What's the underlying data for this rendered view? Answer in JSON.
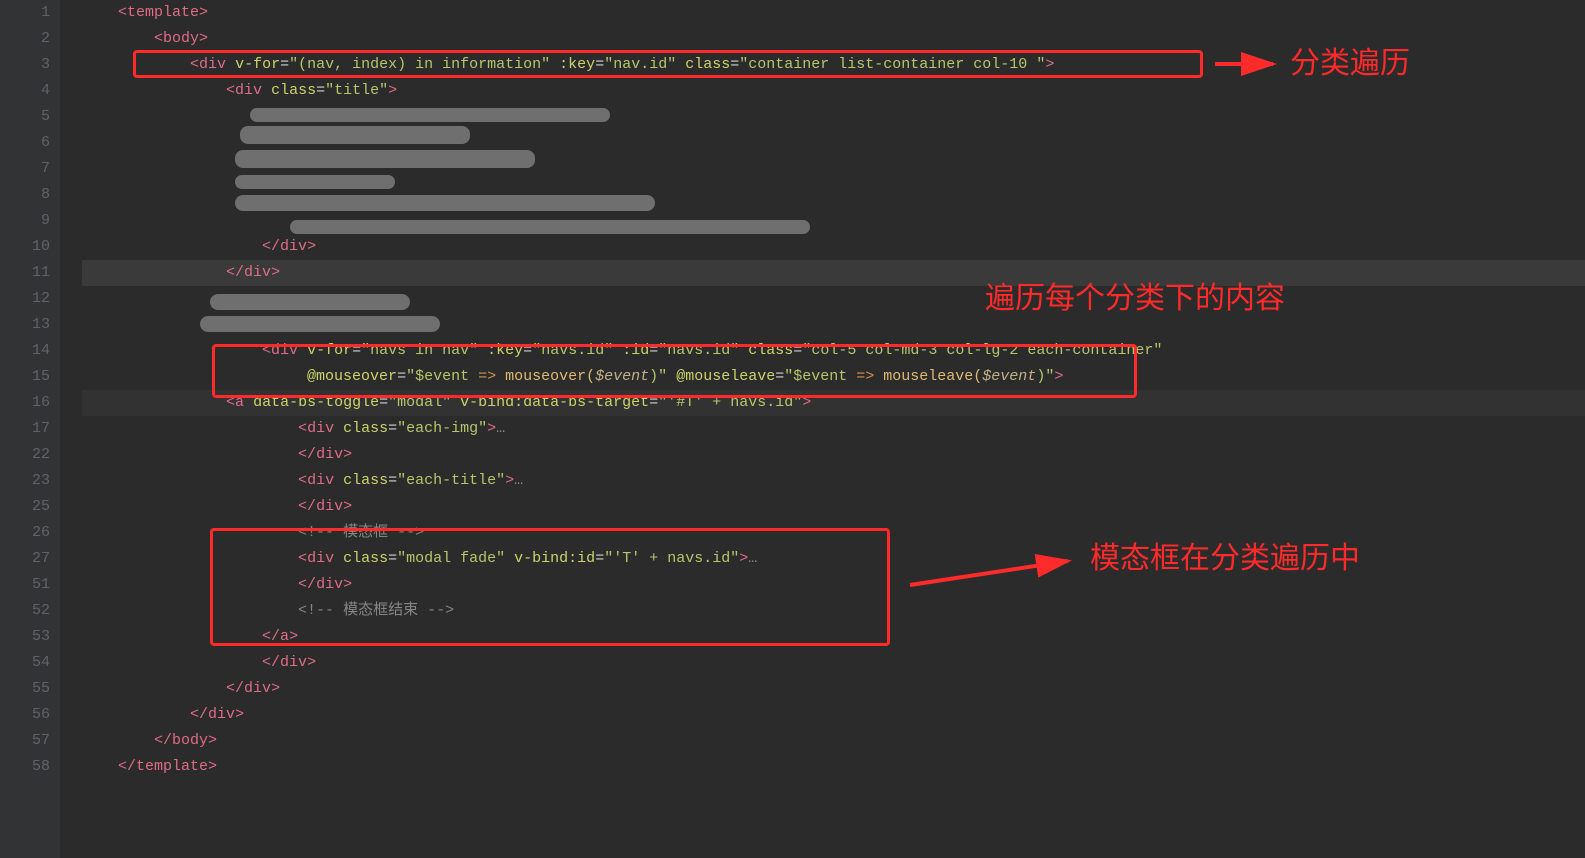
{
  "gutter": {
    "lines": [
      "1",
      "2",
      "3",
      "4",
      "5",
      "6",
      "7",
      "8",
      "9",
      "10",
      "11",
      "12",
      "13",
      "14",
      "15",
      "16",
      "17",
      "22",
      "23",
      "25",
      "26",
      "27",
      "51",
      "52",
      "53",
      "54",
      "55",
      "56",
      "57",
      "58"
    ],
    "fold_rows": [
      "17",
      "27"
    ]
  },
  "code": {
    "l1": {
      "open": "<",
      "tag": "template",
      "close": ">"
    },
    "l2": {
      "open": "<",
      "tag": "body",
      "close": ">"
    },
    "l3": {
      "open": "<",
      "tag": "div",
      "a1": "v-for",
      "v1": "\"(nav, index) in information\"",
      "a2": ":key",
      "v2": "\"nav.id\"",
      "a3": "class",
      "v3": "\"container list-container col-10 \"",
      "close": ">"
    },
    "l4": {
      "open": "<",
      "tag": "div",
      "a1": "class",
      "v1": "\"title\"",
      "close": ">"
    },
    "l10": {
      "open": "</",
      "tag": "div",
      "close": ">"
    },
    "l11": {
      "open": "</",
      "tag": "div",
      "close": ">"
    },
    "l14": {
      "open": "<",
      "tag": "div",
      "a1": "v-for",
      "v1": "\"navs in nav\"",
      "a2": ":key",
      "v2": "\"navs.id\"",
      "a3": ":id",
      "v3": "\"navs.id\"",
      "a4": "class",
      "v4": "\"col-5 col-md-3 col-lg-2 each-container\""
    },
    "l15": {
      "a1": "@mouseover",
      "v1a": "\"$event ",
      "v1b": "=>",
      "v1c": " mouseover(",
      "v1d": "$event",
      "v1e": ")\"",
      "a2": "@mouseleave",
      "v2a": "\"$event ",
      "v2b": "=>",
      "v2c": " mouseleave(",
      "v2d": "$event",
      "v2e": ")\"",
      "close": ">"
    },
    "l16": {
      "open": "<",
      "tag": "a",
      "a1": "data-bs-toggle",
      "v1": "\"modal\"",
      "a2": "v-bind:data-bs-target",
      "v2": "\"'#T' + navs.id\"",
      "close": ">"
    },
    "l17": {
      "open": "<",
      "tag": "div",
      "a1": "class",
      "v1": "\"each-img\"",
      "close": ">",
      "dots": "…"
    },
    "l22": {
      "open": "</",
      "tag": "div",
      "close": ">"
    },
    "l23": {
      "open": "<",
      "tag": "div",
      "a1": "class",
      "v1": "\"each-title\"",
      "close": ">",
      "dots": "…"
    },
    "l25": {
      "open": "</",
      "tag": "div",
      "close": ">"
    },
    "l26": {
      "c_open": "<!--",
      "c_text": " 模态框 ",
      "c_close": "-->"
    },
    "l27": {
      "open": "<",
      "tag": "div",
      "a1": "class",
      "v1": "\"modal fade\"",
      "a2": "v-bind:id",
      "v2": "\"'T' + navs.id\"",
      "close": ">",
      "dots": "…"
    },
    "l51": {
      "open": "</",
      "tag": "div",
      "close": ">"
    },
    "l52": {
      "c_open": "<!--",
      "c_text": " 模态框结束 ",
      "c_close": "-->"
    },
    "l53": {
      "open": "</",
      "tag": "a",
      "close": ">"
    },
    "l54": {
      "open": "</",
      "tag": "div",
      "close": ">"
    },
    "l55": {
      "open": "</",
      "tag": "div",
      "close": ">"
    },
    "l56": {
      "open": "</",
      "tag": "div",
      "close": ">"
    },
    "l57": {
      "open": "</",
      "tag": "body",
      "close": ">"
    },
    "l58": {
      "open": "</",
      "tag": "template",
      "close": ">"
    }
  },
  "annotations": {
    "a1": "分类遍历",
    "a2": "遍历每个分类下的内容",
    "a3": "模态框在分类遍历中"
  }
}
